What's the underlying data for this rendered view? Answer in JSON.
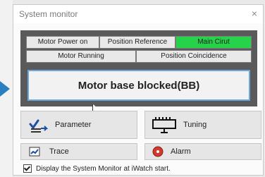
{
  "window": {
    "title": "System monitor",
    "close_glyph": "×"
  },
  "indicators": {
    "motor_power_on": "Motor Power on",
    "position_reference": "Position Reference",
    "main_circuit": "Main Cirut",
    "motor_running": "Motor Running",
    "position_coincidence": "Position Coincidence"
  },
  "status": {
    "text": "Motor base blocked(BB)"
  },
  "buttons": {
    "parameter": "Parameter",
    "tuning": "Tuning",
    "trace": "Trace",
    "alarm": "Alarm"
  },
  "footer": {
    "checkbox_label": "Display the System Monitor at iWatch start.",
    "checked": true
  },
  "colors": {
    "active_indicator": "#26d24a",
    "panel": "#5a5a5a",
    "status_border": "#6aa7dd",
    "alarm_icon": "#d23a2d"
  },
  "icons": {
    "parameter": "parameter-checklist-icon",
    "tuning": "tuning-scale-icon",
    "trace": "trace-icon",
    "alarm": "alarm-red-circle-icon"
  }
}
